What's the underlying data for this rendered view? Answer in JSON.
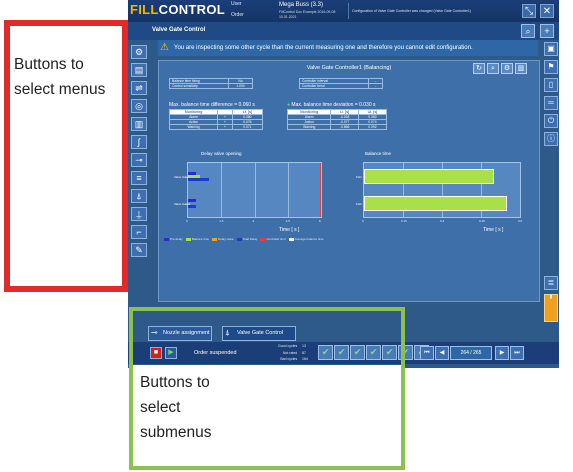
{
  "header": {
    "logo_fill": "FILL",
    "logo_control": "CONTROL",
    "user_label": "User",
    "order_label": "Order",
    "project_name": "Mega Buss (3.3)",
    "project_sub_1": "FillControl Doc Example 2016-09-08",
    "project_sub_2": "10.01.2021",
    "message": "Configuration of Valve Gate Controller was changed (Valve Gate Controller1)"
  },
  "titlebar": {
    "title": "Valve Gate Control"
  },
  "warning": {
    "text": "You are inspecting some other cycle than the current measuring one and therefore you cannot edit configuration."
  },
  "panel": {
    "title": "Valve Gate Controller1 (Balancing)",
    "settings_table": {
      "rows": [
        {
          "label": "Balance time fixing",
          "value": "No"
        },
        {
          "label": "Control sensitivity",
          "value": "1.000"
        }
      ]
    },
    "controller_table": {
      "rows": [
        {
          "label": "Controller interval",
          "value": "-"
        },
        {
          "label": "Controller trend",
          "value": "-"
        }
      ]
    },
    "max_diff": "Max. balance time difference = 0.060 s",
    "max_dev": "Max. balance time deviation = 0.030 s",
    "left_table": {
      "headers": [
        "Monitoring",
        "",
        "Lf. [s]"
      ],
      "rows": [
        {
          "label": "Alarm",
          "sign": "+",
          "value": "0.080"
        },
        {
          "label": "Action",
          "sign": "+",
          "value": "0.076"
        },
        {
          "label": "Warning",
          "sign": "+",
          "value": "0.071"
        }
      ]
    },
    "right_table": {
      "headers": [
        "Monitoring",
        "Ll. [s]",
        "Ul. [s]"
      ],
      "rows": [
        {
          "label": "Alarm",
          "ll": "-0.028",
          "ul": "0.080"
        },
        {
          "label": "Action",
          "ll": "-0.077",
          "ul": "0.074"
        },
        {
          "label": "Warning",
          "ll": "-0.666",
          "ul": "0.092"
        }
      ]
    },
    "legend": {
      "items": [
        {
          "label": "Pre delay",
          "color": "#2c2cc8"
        },
        {
          "label": "Balance time",
          "color": "#a8e04a"
        },
        {
          "label": "Delay valve",
          "color": "#f0a020"
        },
        {
          "label": "Total Delay",
          "color": "#1a3ad0"
        },
        {
          "label": "Controller limit",
          "color": "#e04040"
        },
        {
          "label": "Average balance time",
          "color": "#ffffff"
        }
      ]
    }
  },
  "chart_data": [
    {
      "type": "bar",
      "title": "Delay valve opening",
      "xlabel": "Time [ s ]",
      "ylabel": "",
      "categories": [
        "Valve Gate1",
        "Valve Gate2"
      ],
      "x_ticks": [
        "0",
        "1.5",
        "3",
        "4.5",
        "6"
      ],
      "xlim": [
        0,
        6
      ],
      "limit_line": 6,
      "series": [
        {
          "name": "Pre delay",
          "color": "#2c2cc8",
          "values": [
            0.35,
            0.35
          ]
        },
        {
          "name": "Balance time",
          "color": "#a8e04a",
          "values": [
            0.55,
            0.0
          ]
        },
        {
          "name": "Total Delay",
          "color": "#1a3ad0",
          "values": [
            0.95,
            0.35
          ]
        }
      ]
    },
    {
      "type": "bar",
      "title": "Balance time",
      "xlabel": "Time [ s ]",
      "ylabel": "",
      "categories": [
        "FG1",
        "FG2"
      ],
      "x_ticks": [
        "0",
        "0.15",
        "0.3",
        "0.45",
        "0.6"
      ],
      "xlim": [
        0,
        0.6
      ],
      "series": [
        {
          "name": "Balance time",
          "color": "#a8e04a",
          "values": [
            0.5,
            0.55
          ]
        }
      ]
    }
  ],
  "tabs": [
    {
      "label": "Nozzle assignment",
      "icon": "nozzle-icon"
    },
    {
      "label": "Valve Gate Control",
      "icon": "valve-icon"
    }
  ],
  "status": {
    "order_state": "Order suspended",
    "good_label": "Good cycles",
    "good_value": "13",
    "notrated_label": "Not rated",
    "notrated_value": "87",
    "bad_label": "Bad cycles",
    "bad_value": "164",
    "page": "264 / 265"
  },
  "annotations": {
    "red_label": "Buttons to select menus",
    "green_label": "Buttons to select submenus",
    "red_color": "#e12a2a",
    "green_color": "#8cc152"
  }
}
